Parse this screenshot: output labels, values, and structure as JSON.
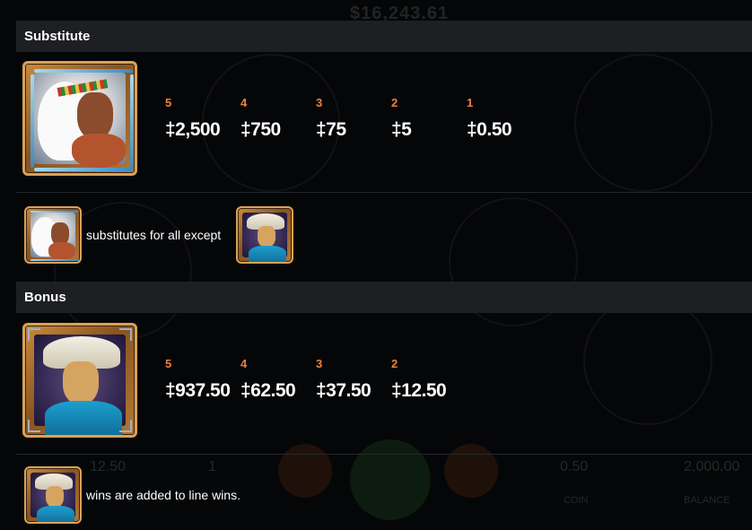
{
  "background": {
    "title_hint": "$16,243.61",
    "bottom_bar": {
      "bet": "12.50",
      "lines": "1",
      "coin": "0.50",
      "balance": "2,000.00",
      "coin_label": "COIN",
      "balance_label": "BALANCE"
    }
  },
  "sections": [
    {
      "title": "Substitute",
      "symbol_icon": "chief-symbol-icon",
      "payouts": [
        {
          "count": "5",
          "amount": "‡2,500"
        },
        {
          "count": "4",
          "amount": "‡750"
        },
        {
          "count": "3",
          "amount": "‡75"
        },
        {
          "count": "2",
          "amount": "‡5"
        },
        {
          "count": "1",
          "amount": "‡0.50"
        }
      ],
      "note": "substitutes for all except"
    },
    {
      "title": "Bonus",
      "symbol_icon": "cowboy-symbol-icon",
      "payouts": [
        {
          "count": "5",
          "amount": "‡937.50"
        },
        {
          "count": "4",
          "amount": "‡62.50"
        },
        {
          "count": "3",
          "amount": "‡37.50"
        },
        {
          "count": "2",
          "amount": "‡12.50"
        }
      ],
      "note": "wins are added to line wins."
    }
  ],
  "colors": {
    "count_orange": "#f0803c",
    "header_bg": "#1e1f22",
    "page_bg": "#050608",
    "frame_gold": "#d8a25a"
  }
}
